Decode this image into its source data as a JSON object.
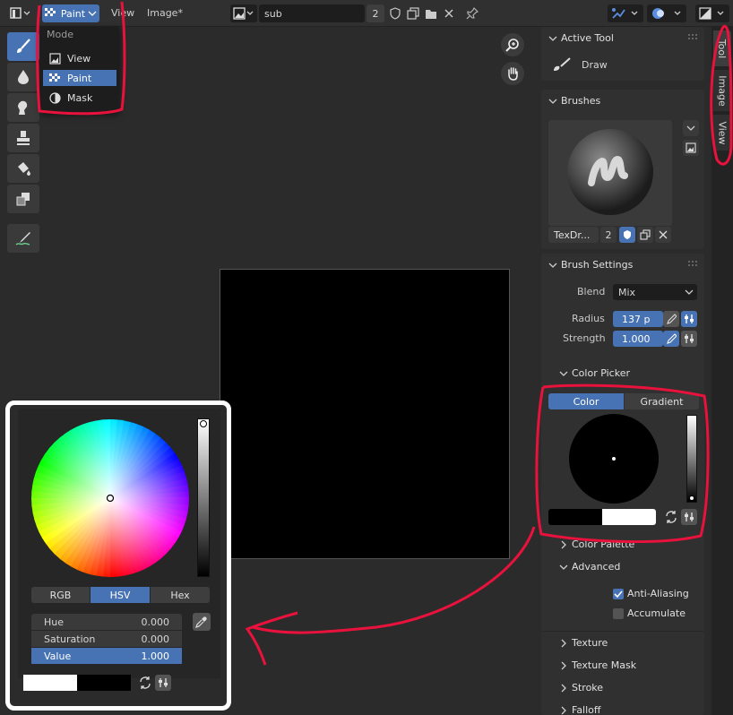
{
  "header": {
    "mode_label": "Paint",
    "menus": [
      "View",
      "Image*"
    ],
    "image_name": "sub",
    "users_count": "2"
  },
  "mode_menu": {
    "title": "Mode",
    "items": [
      {
        "label": "View",
        "icon": "image-icon"
      },
      {
        "label": "Paint",
        "icon": "checker-brush-icon"
      },
      {
        "label": "Mask",
        "icon": "mask-icon"
      }
    ],
    "selected": "Paint"
  },
  "npanel": {
    "active_tool": {
      "title": "Active Tool",
      "tool_name": "Draw"
    },
    "brushes": {
      "title": "Brushes",
      "brush_name": "TexDr...",
      "users": "2"
    },
    "brush_settings": {
      "title": "Brush Settings",
      "blend_label": "Blend",
      "blend_value": "Mix",
      "radius_label": "Radius",
      "radius_value": "137 p",
      "strength_label": "Strength",
      "strength_value": "1.000"
    },
    "color_picker": {
      "title": "Color Picker",
      "tab_color": "Color",
      "tab_gradient": "Gradient"
    },
    "color_palette": {
      "title": "Color Palette"
    },
    "advanced": {
      "title": "Advanced",
      "anti_aliasing": "Anti-Aliasing",
      "anti_aliasing_checked": true,
      "accumulate": "Accumulate",
      "accumulate_checked": false
    },
    "collapsed_panels": [
      "Texture",
      "Texture Mask",
      "Stroke",
      "Falloff"
    ]
  },
  "vtabs": [
    "Tool",
    "Image",
    "View"
  ],
  "picker_popup": {
    "tabs": [
      "RGB",
      "HSV",
      "Hex"
    ],
    "selected_tab": "HSV",
    "fields": [
      {
        "label": "Hue",
        "value": "0.000"
      },
      {
        "label": "Saturation",
        "value": "0.000"
      },
      {
        "label": "Value",
        "value": "1.000"
      }
    ]
  },
  "colors": {
    "accent": "#4772b3",
    "annotation": "#e8123c",
    "frame": "#ffffff"
  }
}
